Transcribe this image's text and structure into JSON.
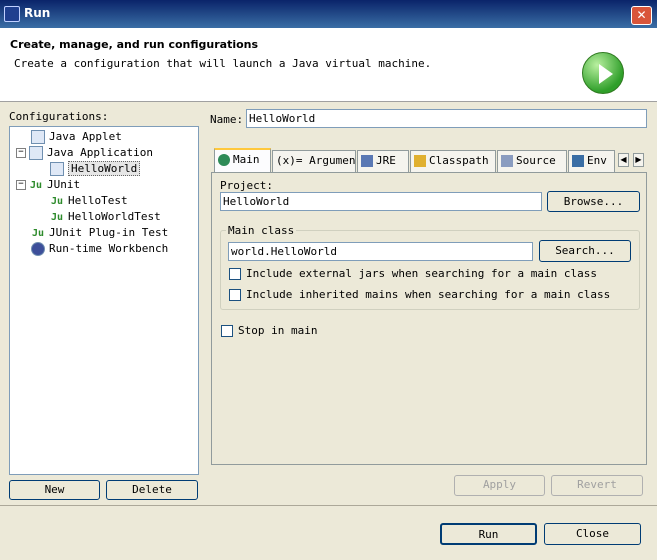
{
  "window": {
    "title": "Run",
    "close_label": "✕"
  },
  "header": {
    "title": "Create, manage, and run configurations",
    "description": "Create a configuration that will launch a Java virtual machine."
  },
  "configurations": {
    "label": "Configurations:",
    "items": [
      {
        "label": "Java Applet"
      },
      {
        "label": "Java Application",
        "expander": "−"
      },
      {
        "label": "HelloWorld"
      },
      {
        "label": "JUnit",
        "expander": "−",
        "icon_text": "Ju"
      },
      {
        "label": "HelloTest",
        "icon_text": "Ju"
      },
      {
        "label": "HelloWorldTest",
        "icon_text": "Ju"
      },
      {
        "label": "JUnit Plug-in Test",
        "icon_text": "Ju"
      },
      {
        "label": "Run-time Workbench"
      }
    ],
    "new_button": "New",
    "delete_button": "Delete"
  },
  "name_field": {
    "label": "Name:",
    "value": "HelloWorld"
  },
  "tabs": [
    {
      "label": "Main"
    },
    {
      "label": "Arguments",
      "icon_text": "(x)="
    },
    {
      "label": "JRE"
    },
    {
      "label": "Classpath"
    },
    {
      "label": "Source"
    },
    {
      "label": "Env"
    }
  ],
  "tab_scroll": {
    "left": "◀",
    "right": "▶"
  },
  "main_tab": {
    "project_label": "Project:",
    "project_value": "HelloWorld",
    "browse_button": "Browse...",
    "main_class_label": "Main class",
    "main_class_value": "world.HelloWorld",
    "search_button": "Search...",
    "include_external_jars": "Include external jars when searching for a main class",
    "include_inherited_mains": "Include inherited mains when searching for a main class",
    "stop_in_main": "Stop in main"
  },
  "actions": {
    "apply": "Apply",
    "revert": "Revert",
    "run": "Run",
    "close": "Close"
  }
}
